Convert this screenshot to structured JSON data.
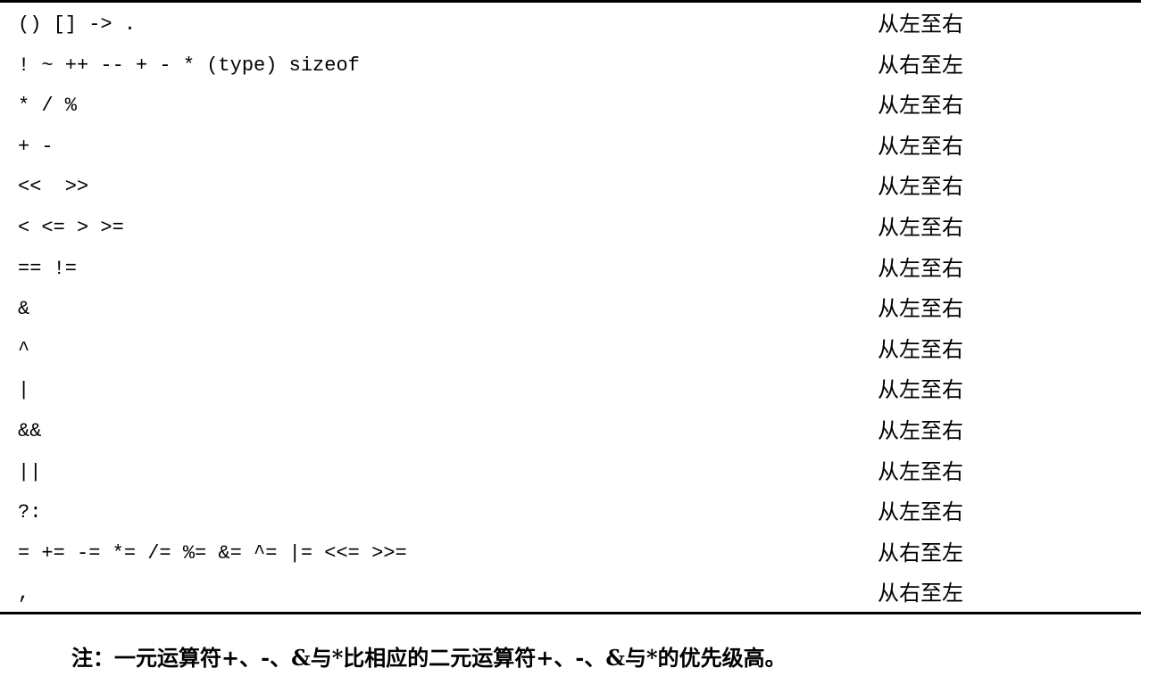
{
  "table": {
    "rows": [
      {
        "operators": "() [] -> .",
        "associativity": "从左至右"
      },
      {
        "operators": "! ~ ++ -- + - * (type) sizeof",
        "associativity": "从右至左"
      },
      {
        "operators": "* / %",
        "associativity": "从左至右"
      },
      {
        "operators": "+ -",
        "associativity": "从左至右"
      },
      {
        "operators": "<<  >>",
        "associativity": "从左至右"
      },
      {
        "operators": "< <= > >=",
        "associativity": "从左至右"
      },
      {
        "operators": "== !=",
        "associativity": "从左至右"
      },
      {
        "operators": "&",
        "associativity": "从左至右"
      },
      {
        "operators": "^",
        "associativity": "从左至右"
      },
      {
        "operators": "|",
        "associativity": "从左至右"
      },
      {
        "operators": "&&",
        "associativity": "从左至右"
      },
      {
        "operators": "||",
        "associativity": "从左至右"
      },
      {
        "operators": "?:",
        "associativity": "从左至右"
      },
      {
        "operators": "= += -= *= /= %= &= ^= |= <<= >>=",
        "associativity": "从右至左"
      },
      {
        "operators": ",",
        "associativity": "从右至左"
      }
    ]
  },
  "note": "注：一元运算符+、-、&与*比相应的二元运算符+、-、&与*的优先级高。"
}
